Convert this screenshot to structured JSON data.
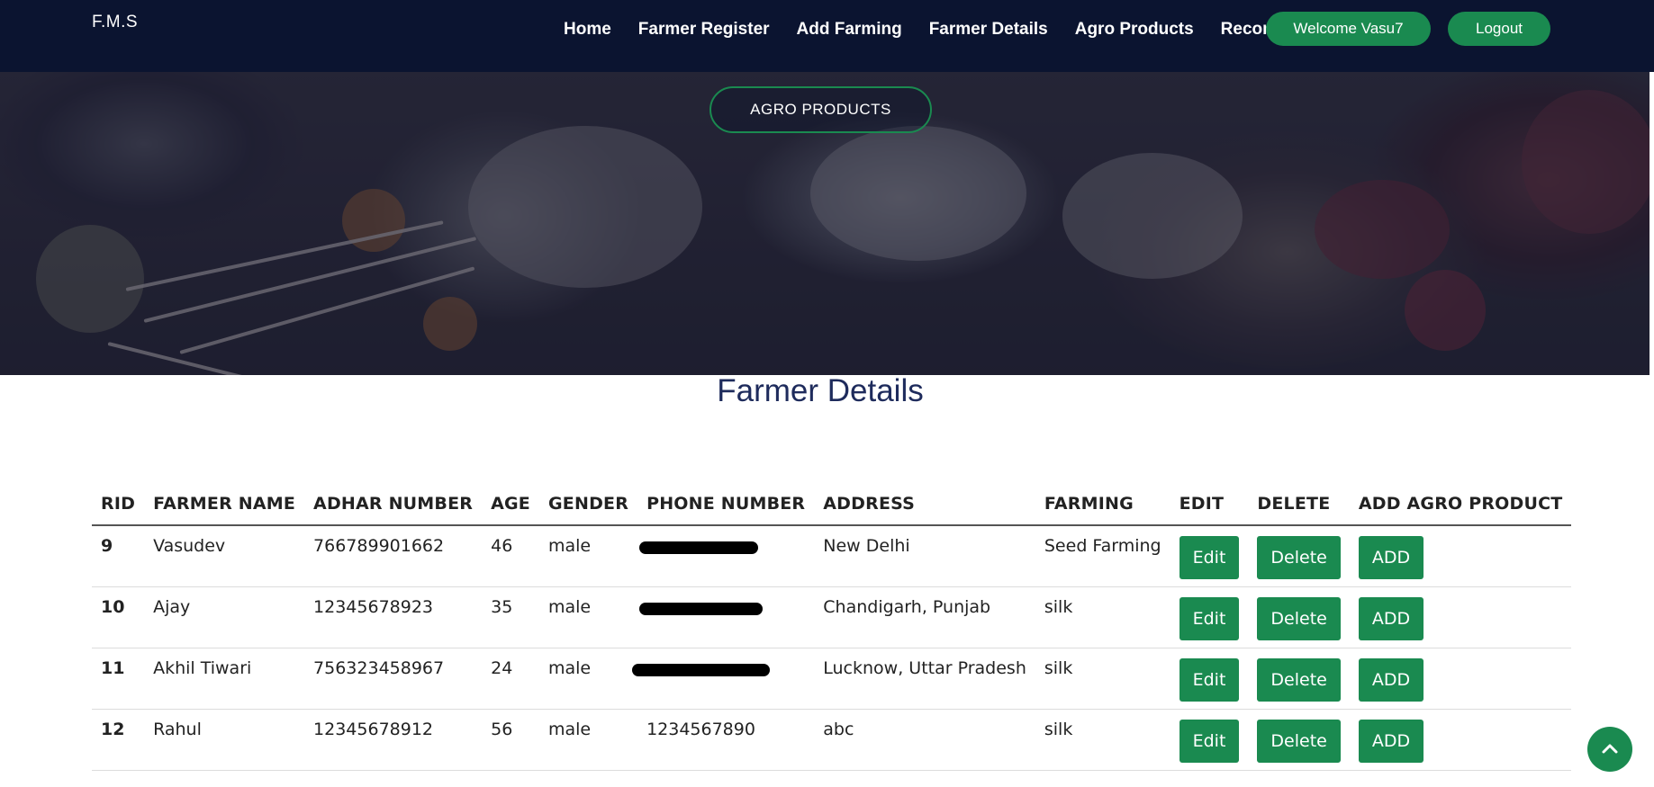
{
  "brand": "F.M.S",
  "nav": {
    "links": [
      "Home",
      "Farmer Register",
      "Add Farming",
      "Farmer Details",
      "Agro Products",
      "Records"
    ],
    "welcome": "Welcome Vasu7",
    "logout": "Logout"
  },
  "hero": {
    "button_label": "AGRO PRODUCTS"
  },
  "page_title": "Farmer Details",
  "table": {
    "headers": [
      "RID",
      "FARMER NAME",
      "ADHAR NUMBER",
      "AGE",
      "GENDER",
      "PHONE NUMBER",
      "ADDRESS",
      "FARMING",
      "EDIT",
      "DELETE",
      "ADD AGRO PRODUCT"
    ],
    "rows": [
      {
        "rid": "9",
        "name": "Vasudev",
        "adhar": "766789901662",
        "age": "46",
        "gender": "male",
        "phone": "",
        "phone_redacted": true,
        "address": "New Delhi",
        "farming": "Seed Farming"
      },
      {
        "rid": "10",
        "name": "Ajay",
        "adhar": "12345678923",
        "age": "35",
        "gender": "male",
        "phone": "",
        "phone_redacted": true,
        "address": "Chandigarh, Punjab",
        "farming": "silk"
      },
      {
        "rid": "11",
        "name": "Akhil Tiwari",
        "adhar": "756323458967",
        "age": "24",
        "gender": "male",
        "phone": "",
        "phone_redacted": true,
        "address": "Lucknow, Uttar Pradesh",
        "farming": "silk"
      },
      {
        "rid": "12",
        "name": "Rahul",
        "adhar": "12345678912",
        "age": "56",
        "gender": "male",
        "phone": "1234567890",
        "phone_redacted": false,
        "address": "abc",
        "farming": "silk"
      }
    ],
    "edit_label": "Edit",
    "delete_label": "Delete",
    "add_label": "ADD"
  },
  "colors": {
    "navbar": "#0b1430",
    "accent": "#1a8a50",
    "title": "#1e2b5c"
  },
  "icons": {
    "scroll_top": "chevron-up-icon"
  }
}
